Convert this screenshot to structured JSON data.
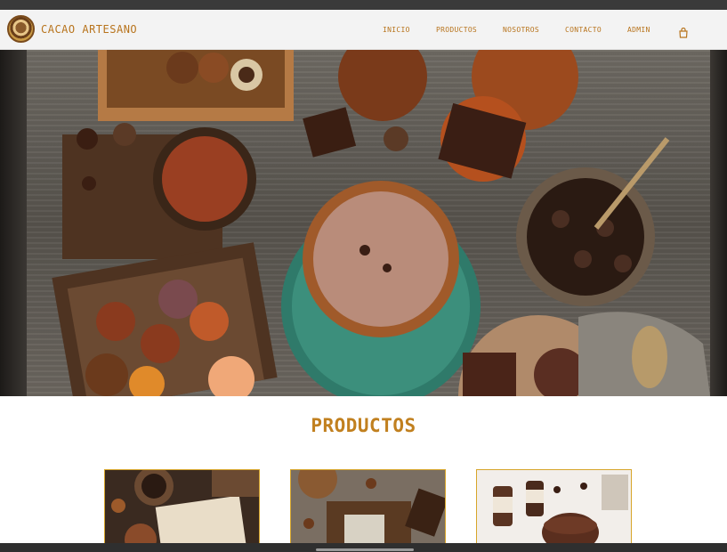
{
  "brand": {
    "name": "CACAO ARTESANO",
    "logo_icon": "cacao-logo-icon"
  },
  "nav": {
    "items": [
      {
        "label": "INICIO"
      },
      {
        "label": "PRODUCTOS"
      },
      {
        "label": "NOSOTROS"
      },
      {
        "label": "CONTACTO"
      },
      {
        "label": "ADMIN"
      }
    ],
    "cart_icon": "shopping-bag-icon"
  },
  "hero": {
    "image": "chocolate-table-photo"
  },
  "products": {
    "title": "PRODUCTOS",
    "cards": [
      {
        "image": "cocoa-packaging-photo"
      },
      {
        "image": "cocoa-cream-jar-photo"
      },
      {
        "image": "chocolate-bottles-cake-photo"
      }
    ]
  },
  "colors": {
    "accent": "#c1801f",
    "nav_bg": "#f3f3f3",
    "card_border": "#d7a52a"
  }
}
